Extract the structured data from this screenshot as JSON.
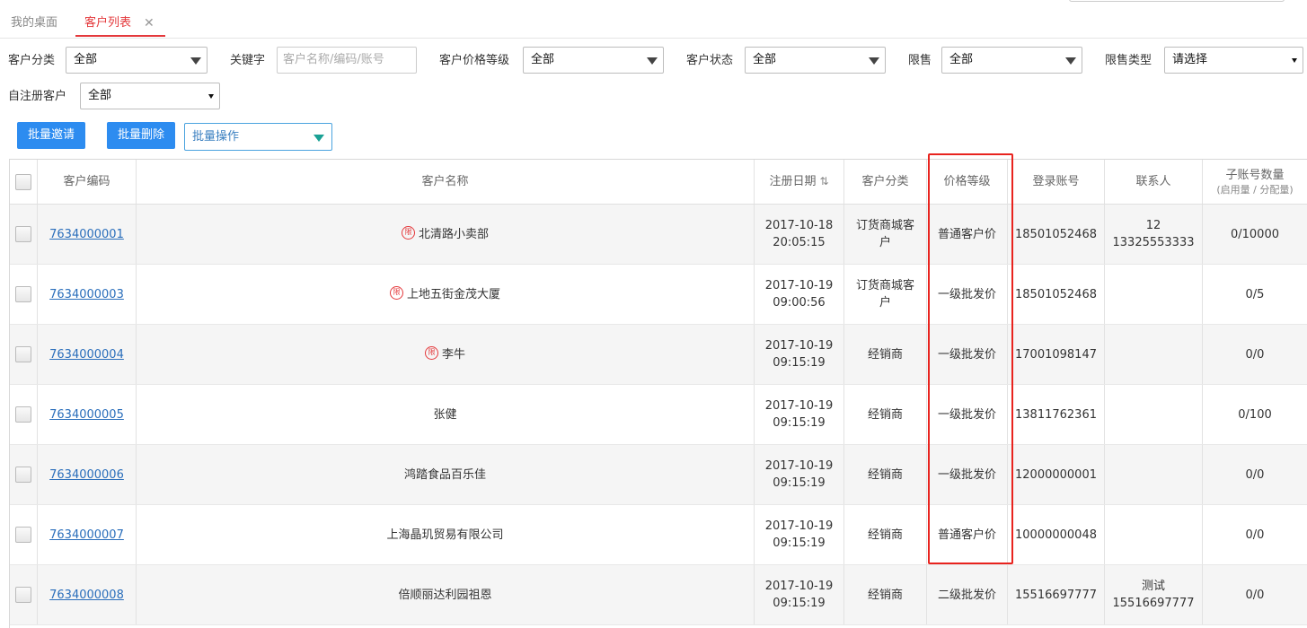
{
  "tabs": [
    {
      "label": "我的桌面"
    },
    {
      "label": "客户列表",
      "close": "✕"
    }
  ],
  "filters": {
    "category": {
      "label": "客户分类",
      "value": "全部"
    },
    "keyword": {
      "label": "关键字",
      "placeholder": "客户名称/编码/账号"
    },
    "price_level": {
      "label": "客户价格等级",
      "value": "全部"
    },
    "status": {
      "label": "客户状态",
      "value": "全部"
    },
    "restrict": {
      "label": "限售",
      "value": "全部"
    },
    "restrict_type": {
      "label": "限售类型",
      "value": "请选择"
    },
    "self_register": {
      "label": "自注册客户",
      "value": "全部"
    }
  },
  "actions": {
    "invite": "批量邀请",
    "delete": "批量删除",
    "batch": "批量操作"
  },
  "table": {
    "headers": {
      "code": "客户编码",
      "name": "客户名称",
      "reg_date": "注册日期",
      "sort_icon": "⇅",
      "category": "客户分类",
      "price_level": "价格等级",
      "account": "登录账号",
      "contact": "联系人",
      "sub_count": "子账号数量",
      "sub_count_note": "(启用量 / 分配量)"
    },
    "limit_icon": "限",
    "rows": [
      {
        "code": "7634000001",
        "limited": true,
        "name": "北清路小卖部",
        "date": "2017-10-18",
        "time": "20:05:15",
        "category": "订货商城客户",
        "price_level": "普通客户价",
        "account": "18501052468",
        "contact_1": "12",
        "contact_2": "13325553333",
        "sub_count": "0/10000"
      },
      {
        "code": "7634000003",
        "limited": true,
        "name": "上地五街金茂大厦",
        "date": "2017-10-19",
        "time": "09:00:56",
        "category": "订货商城客户",
        "price_level": "一级批发价",
        "account": "18501052468",
        "contact_1": "",
        "contact_2": "",
        "sub_count": "0/5"
      },
      {
        "code": "7634000004",
        "limited": true,
        "name": "李牛",
        "date": "2017-10-19",
        "time": "09:15:19",
        "category": "经销商",
        "price_level": "一级批发价",
        "account": "17001098147",
        "contact_1": "",
        "contact_2": "",
        "sub_count": "0/0"
      },
      {
        "code": "7634000005",
        "limited": false,
        "name": "张健",
        "date": "2017-10-19",
        "time": "09:15:19",
        "category": "经销商",
        "price_level": "一级批发价",
        "account": "13811762361",
        "contact_1": "",
        "contact_2": "",
        "sub_count": "0/100"
      },
      {
        "code": "7634000006",
        "limited": false,
        "name": "鸿踏食品百乐佳",
        "date": "2017-10-19",
        "time": "09:15:19",
        "category": "经销商",
        "price_level": "一级批发价",
        "account": "12000000001",
        "contact_1": "",
        "contact_2": "",
        "sub_count": "0/0"
      },
      {
        "code": "7634000007",
        "limited": false,
        "name": "上海晶玑贸易有限公司",
        "date": "2017-10-19",
        "time": "09:15:19",
        "category": "经销商",
        "price_level": "普通客户价",
        "account": "10000000048",
        "contact_1": "",
        "contact_2": "",
        "sub_count": "0/0"
      },
      {
        "code": "7634000008",
        "limited": false,
        "name": "倍顺丽达利园祖恩",
        "date": "2017-10-19",
        "time": "09:15:19",
        "category": "经销商",
        "price_level": "二级批发价",
        "account": "15516697777",
        "contact_1": "测试",
        "contact_2": "15516697777",
        "sub_count": "0/0"
      }
    ]
  },
  "colors": {
    "accent_red": "#e4393c",
    "button_blue": "#2d8cf0",
    "link_blue": "#2a6ebb",
    "highlight_box": "#e8231e"
  }
}
